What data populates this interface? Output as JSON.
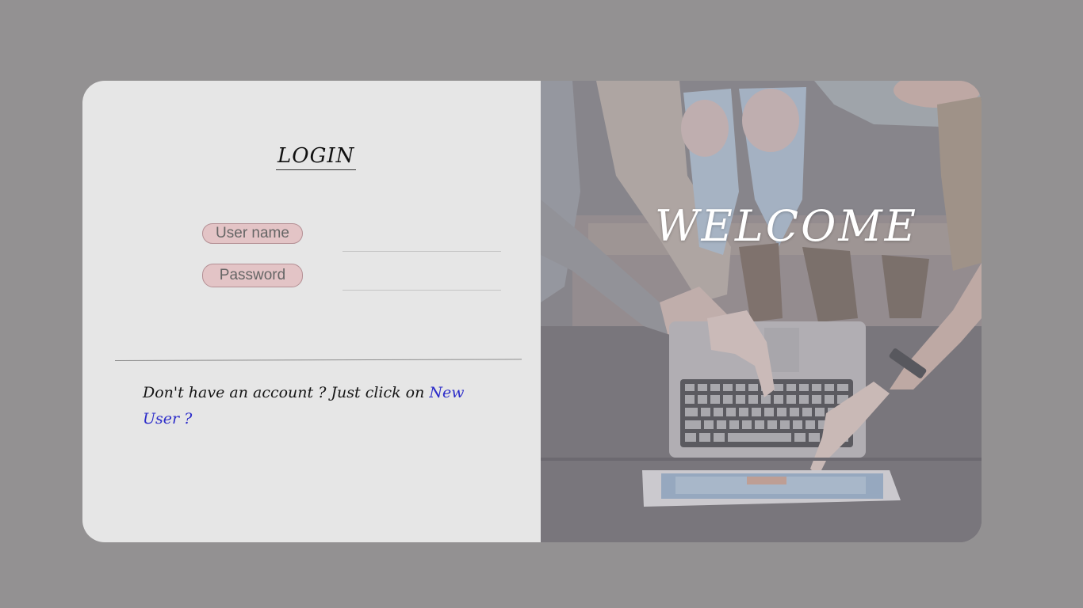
{
  "login": {
    "title": "LOGIN",
    "username_label": "User name",
    "password_label": "Password",
    "username_value": "",
    "password_value": ""
  },
  "signup": {
    "prompt": "Don't have an account ? Just click on",
    "link": "New User ?"
  },
  "hero": {
    "welcome": "WELCOME"
  },
  "colors": {
    "background": "#939192",
    "panel": "#e6e6e6",
    "label_pill": "#e3c4c6",
    "link": "#2b2bc9"
  }
}
